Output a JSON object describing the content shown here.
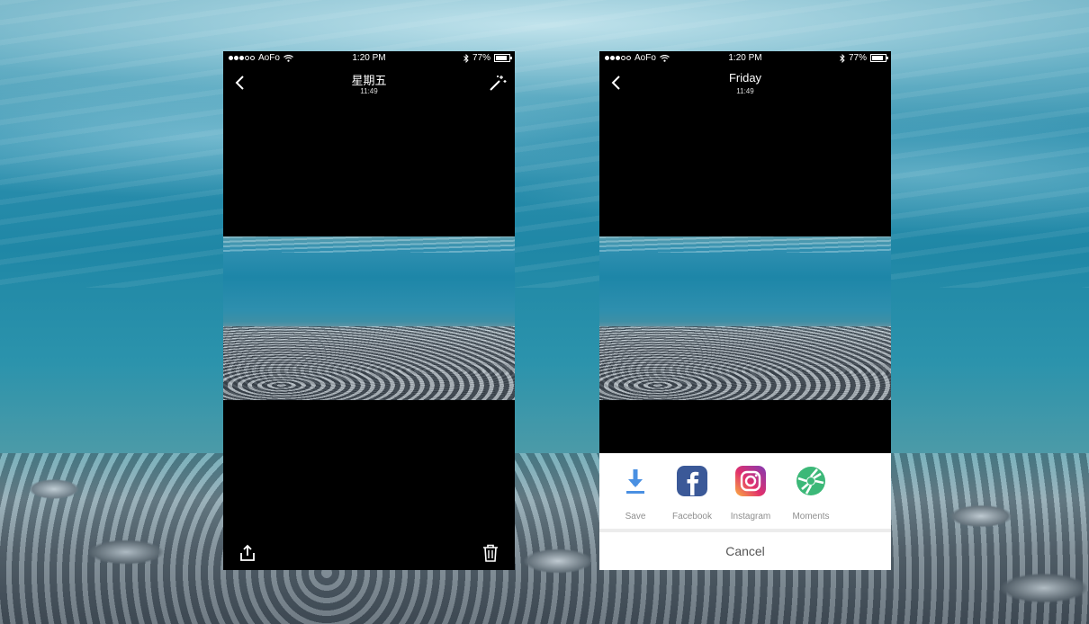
{
  "status": {
    "carrier": "AoFo",
    "time": "1:20 PM",
    "battery": "77%",
    "battery_fraction": 0.77
  },
  "left_screen": {
    "title": "星期五",
    "subtitle": "11:49"
  },
  "right_screen": {
    "title": "Friday",
    "subtitle": "11:49",
    "share_sheet": {
      "items": [
        {
          "label": "Save",
          "icon": "download-icon",
          "color": "#4a90e2"
        },
        {
          "label": "Facebook",
          "icon": "facebook-icon",
          "color": "#3b5998"
        },
        {
          "label": "Instagram",
          "icon": "instagram-icon",
          "color": "#d6246e"
        },
        {
          "label": "Moments",
          "icon": "moments-icon",
          "color": "#3cb878"
        }
      ],
      "cancel_label": "Cancel"
    }
  }
}
